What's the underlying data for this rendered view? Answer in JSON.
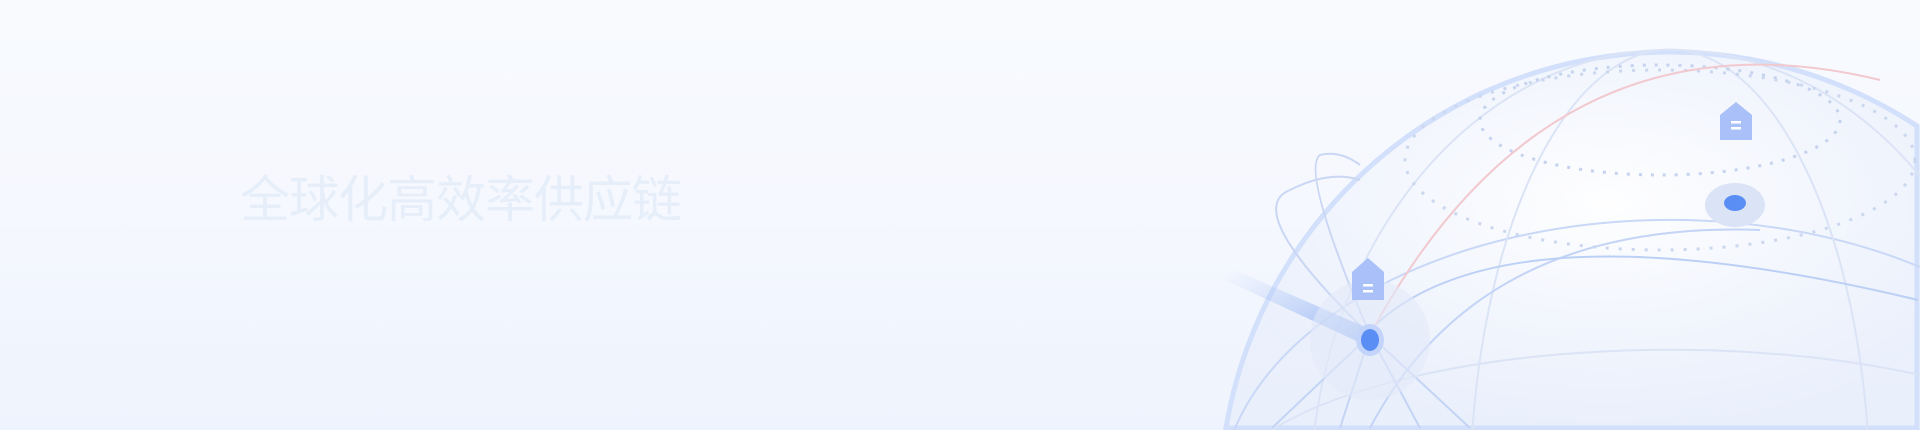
{
  "banner": {
    "title": "全球化高效率供应链",
    "accent_color": "#5b8ef5",
    "illustration": "globe-network-icon"
  }
}
